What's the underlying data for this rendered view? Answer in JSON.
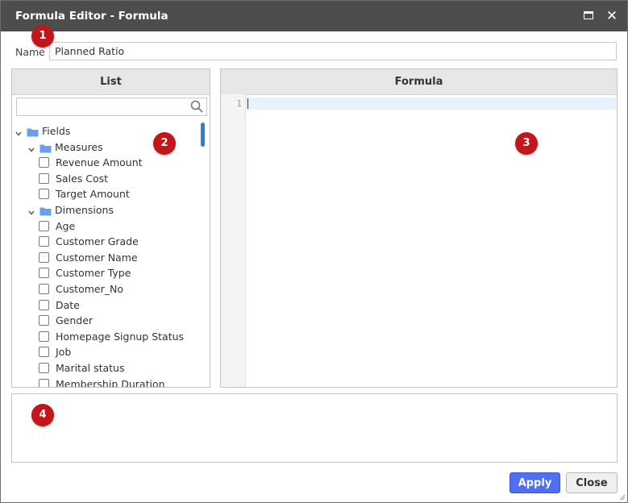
{
  "window": {
    "title": "Formula Editor - Formula"
  },
  "name_field": {
    "label": "Name",
    "value": "Planned Ratio"
  },
  "list_panel": {
    "header": "List",
    "search_placeholder": "",
    "tree": {
      "root": "Fields",
      "groups": [
        {
          "label": "Measures",
          "items": [
            "Revenue Amount",
            "Sales Cost",
            "Target Amount"
          ]
        },
        {
          "label": "Dimensions",
          "items": [
            "Age",
            "Customer Grade",
            "Customer Name",
            "Customer Type",
            "Customer_No",
            "Date",
            "Gender",
            "Homepage Signup Status",
            "Job",
            "Marital status",
            "Membership Duration"
          ]
        }
      ]
    }
  },
  "formula_panel": {
    "header": "Formula",
    "line_number": "1",
    "content": ""
  },
  "buttons": {
    "apply": "Apply",
    "close": "Close"
  },
  "markers": [
    "1",
    "2",
    "3",
    "4"
  ],
  "colors": {
    "titlebar": "#4d4d4d",
    "marker": "#c2161b",
    "apply": "#4f6ef0",
    "folder": "#6d9eeb",
    "scroll_thumb": "#2f7fd8"
  }
}
